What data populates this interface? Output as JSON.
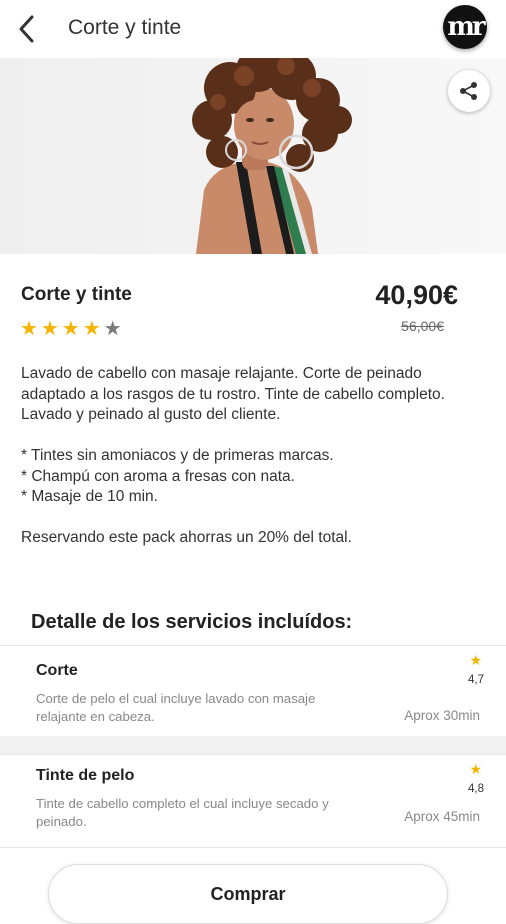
{
  "header": {
    "title": "Corte y tinte",
    "logo_text": "mr"
  },
  "hero": {
    "image_icon": "portrait-photo",
    "share_icon": "share-icon"
  },
  "pack": {
    "name": "Corte y tinte",
    "price": "40,90€",
    "old_price": "56,00€",
    "rating_stars": 4,
    "max_stars": 5,
    "star_color": "#f5b400",
    "star_empty_color": "#7a7a7a",
    "description": [
      "Lavado de cabello con masaje relajante. Corte de peinado adaptado a los rasgos de tu rostro. Tinte de cabello completo. Lavado y peinado al gusto del cliente.",
      "",
      "* Tintes sin amoniacos y de primeras marcas.",
      "* Champú con aroma a fresas con nata.",
      "* Masaje de 10 min.",
      "",
      "Reservando este pack ahorras un 20% del total."
    ]
  },
  "services": {
    "title": "Detalle de los servicios incluídos:",
    "items": [
      {
        "name": "Corte",
        "description": "Corte de pelo el cual incluye lavado con masaje relajante en cabeza.",
        "rating": "4,7",
        "duration": "Aprox 30min"
      },
      {
        "name": "Tinte de pelo",
        "description": "Tinte de cabello completo el cual incluye secado y peinado.",
        "rating": "4,8",
        "duration": "Aprox 45min"
      }
    ]
  },
  "actions": {
    "buy_label": "Comprar"
  }
}
